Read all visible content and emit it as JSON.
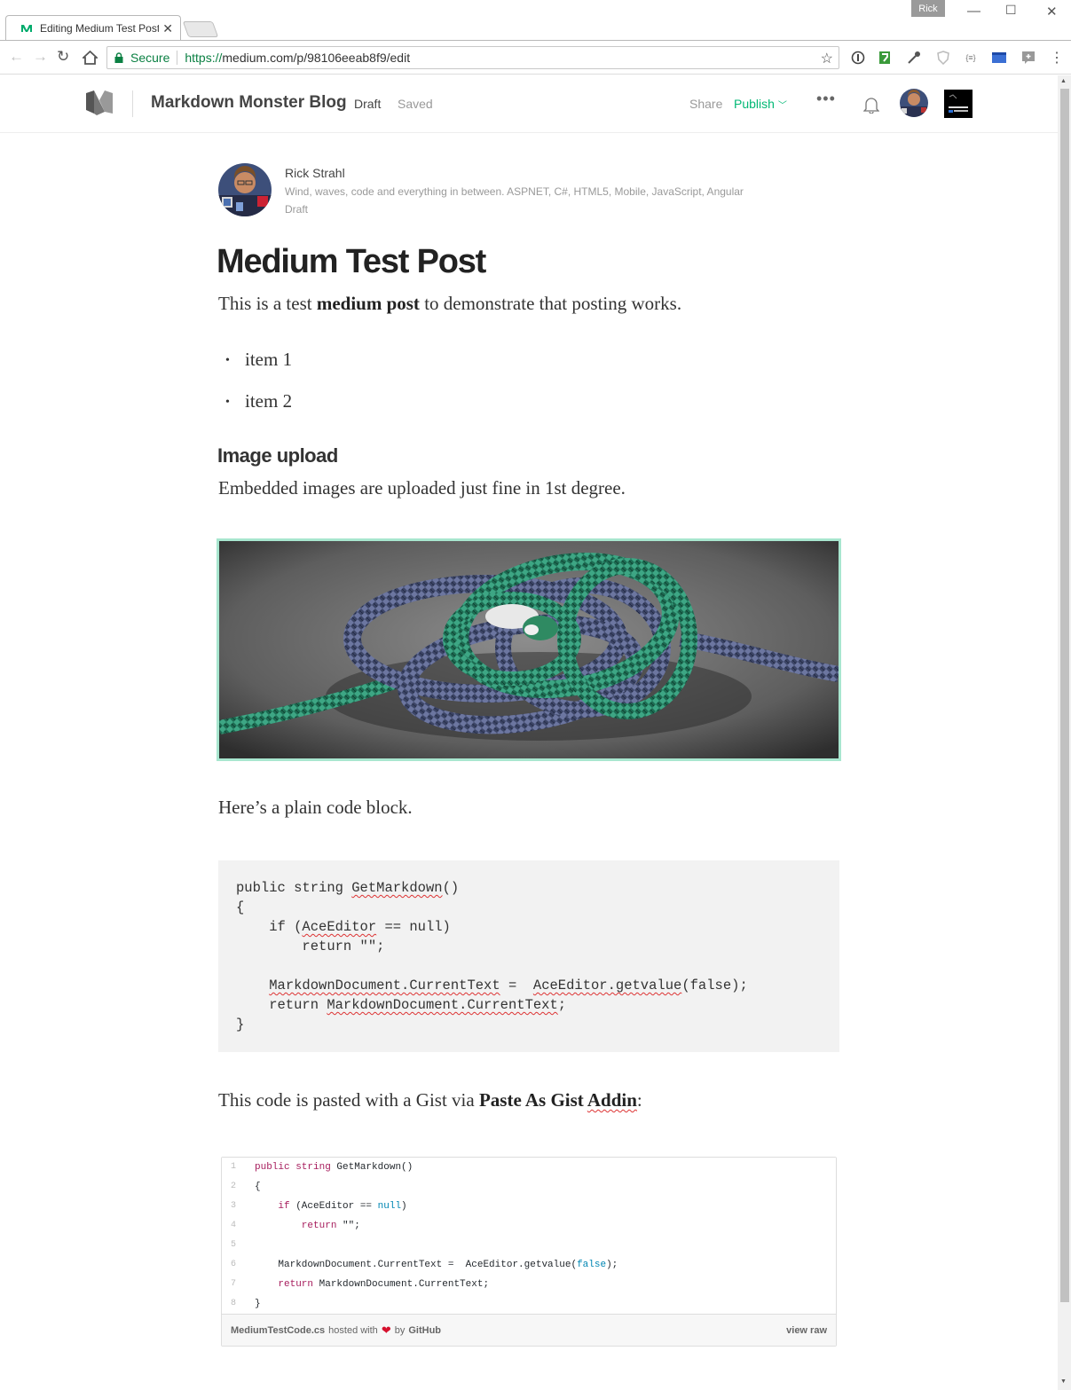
{
  "browser": {
    "tab_title": "Editing Medium Test Post",
    "user_chip": "Rick",
    "secure_label": "Secure",
    "url_proto": "https://",
    "url_rest": "medium.com/p/98106eeab8f9/edit",
    "ext_json_label": "{≡}"
  },
  "header": {
    "publication": "Markdown Monster Blog",
    "status": "Draft",
    "saved": "Saved",
    "share": "Share",
    "publish": "Publish",
    "more": "•••"
  },
  "author": {
    "name": "Rick Strahl",
    "bio": "Wind, waves, code and everything in between. ASPNET, C#, HTML5, Mobile, JavaScript, Angular",
    "status": "Draft"
  },
  "post": {
    "title": "Medium Test Post",
    "intro_pre": "This is a test ",
    "intro_bold": "medium post",
    "intro_post": " to demonstrate that posting works.",
    "list": [
      "item 1",
      "item 2"
    ],
    "heading": "Image upload",
    "image_text": "Embedded images are uploaded just fine in 1st degree.",
    "code_intro": "Here’s a plain code block.",
    "gist_intro_pre": "This code is pasted with a Gist via ",
    "gist_intro_bold_1": "Paste As Gist ",
    "gist_intro_bold_2": "Addin",
    "gist_intro_post": ":"
  },
  "codeblock": {
    "l1a": "public string ",
    "l1b": "GetMarkdown",
    "l1c": "()",
    "l2": "{",
    "l3a": "    if (",
    "l3b": "AceEditor",
    "l3c": " == null)",
    "l4": "        return \"\";",
    "l6a": "    ",
    "l6b": "MarkdownDocument.CurrentText",
    "l6c": " =  ",
    "l6d": "AceEditor.getvalue",
    "l6e": "(false);",
    "l7a": "    return ",
    "l7b": "MarkdownDocument.CurrentText",
    "l7c": ";",
    "l8": "}"
  },
  "gist": {
    "line_numbers": [
      "1",
      "2",
      "3",
      "4",
      "5",
      "6",
      "7",
      "8"
    ],
    "l1_kw": "public string",
    "l1_rest": " GetMarkdown()",
    "l2": "{",
    "l3_kw": "    if",
    "l3_a": " (AceEditor == ",
    "l3_lit": "null",
    "l3_b": ")",
    "l4_kw": "        return",
    "l4_rest": " \"\";",
    "l6_a": "    MarkdownDocument.CurrentText =  AceEditor.getvalue(",
    "l6_lit": "false",
    "l6_b": ");",
    "l7_kw": "    return",
    "l7_rest": " MarkdownDocument.CurrentText;",
    "l8": "}",
    "filename": "MediumTestCode.cs",
    "hosted_with": "hosted with",
    "by": "by",
    "github": "GitHub",
    "view_raw": "view raw"
  },
  "colors": {
    "accent_green": "#02b875",
    "figure_border": "#a8e6cf",
    "code_bg": "#f2f2f2"
  }
}
